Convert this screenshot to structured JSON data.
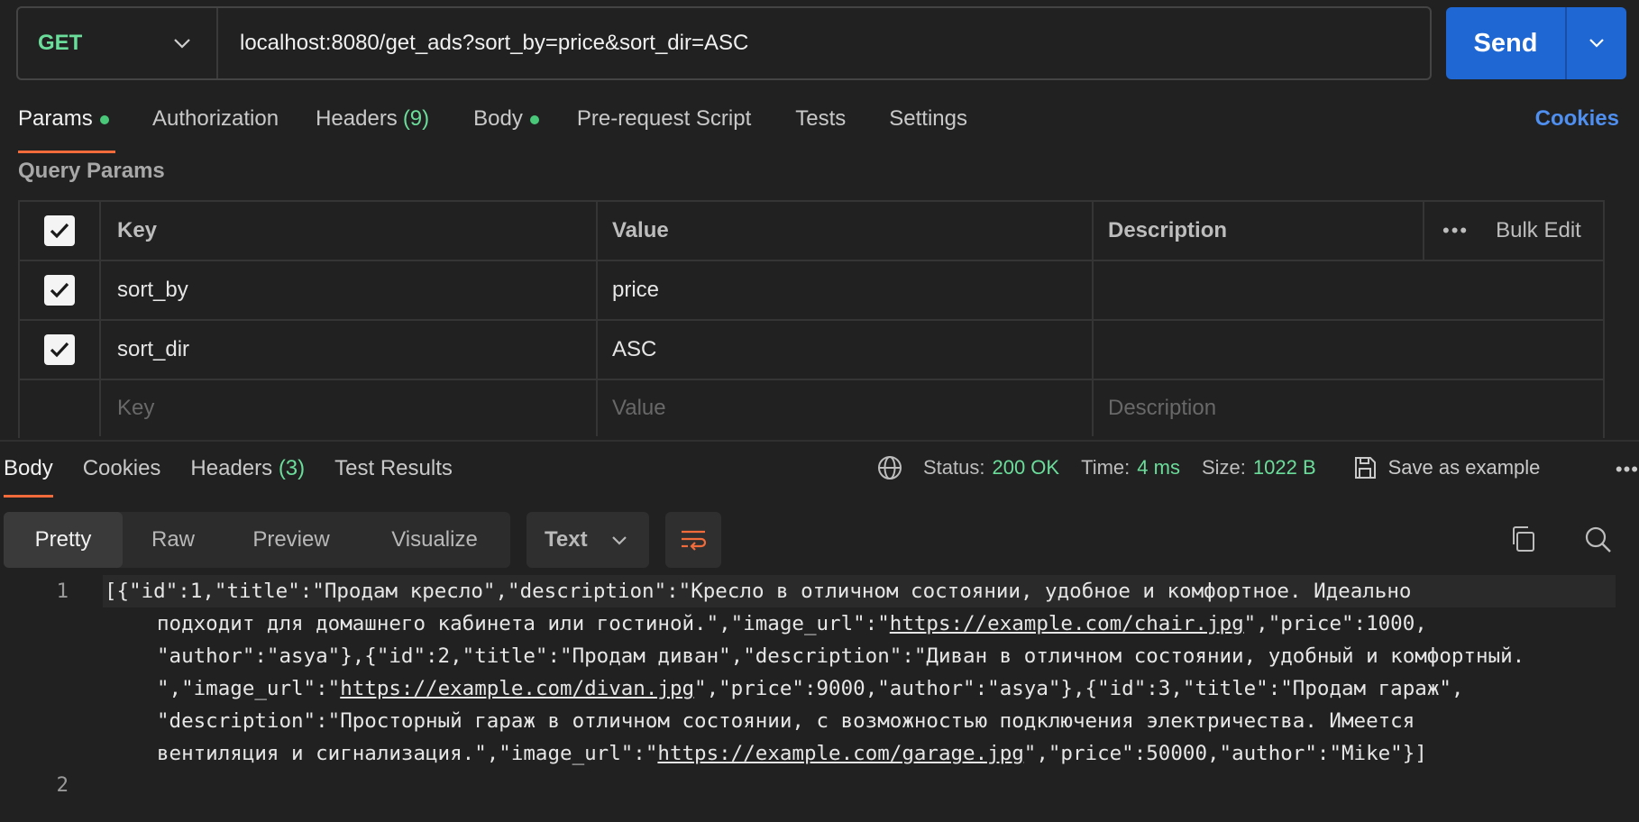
{
  "request": {
    "method": "GET",
    "url": "localhost:8080/get_ads?sort_by=price&sort_dir=ASC",
    "send_label": "Send"
  },
  "req_tabs": {
    "params": "Params",
    "authorization": "Authorization",
    "headers": "Headers",
    "headers_count": "(9)",
    "body": "Body",
    "pre_request": "Pre-request Script",
    "tests": "Tests",
    "settings": "Settings",
    "cookies": "Cookies"
  },
  "query_params": {
    "title": "Query Params",
    "headers": {
      "key": "Key",
      "value": "Value",
      "description": "Description",
      "bulk_edit": "Bulk Edit"
    },
    "rows": [
      {
        "key": "sort_by",
        "value": "price",
        "description": ""
      },
      {
        "key": "sort_dir",
        "value": "ASC",
        "description": ""
      }
    ],
    "placeholders": {
      "key": "Key",
      "value": "Value",
      "description": "Description"
    }
  },
  "response": {
    "tabs": {
      "body": "Body",
      "cookies": "Cookies",
      "headers": "Headers",
      "headers_count": "(3)",
      "test_results": "Test Results"
    },
    "status_label": "Status:",
    "status_value": "200 OK",
    "time_label": "Time:",
    "time_value": "4 ms",
    "size_label": "Size:",
    "size_value": "1022 B",
    "save_example": "Save as example",
    "views": {
      "pretty": "Pretty",
      "raw": "Raw",
      "preview": "Preview",
      "visualize": "Visualize"
    },
    "format": "Text",
    "code": {
      "line_numbers": [
        "1",
        "2"
      ],
      "l1": "[{\"id\":1,\"title\":\"Продам кресло\",\"description\":\"Кресло в отличном состоянии, удобное и комфортное. Идеально",
      "l2a": "подходит для домашнего кабинета или гостиной.\",\"image_url\":\"",
      "l2url": "https://example.com/chair.jpg",
      "l2b": "\",\"price\":1000,",
      "l3": "\"author\":\"asya\"},{\"id\":2,\"title\":\"Продам диван\",\"description\":\"Диван в отличном состоянии, удобный и комфортный.",
      "l4a": "\",\"image_url\":\"",
      "l4url": "https://example.com/divan.jpg",
      "l4b": "\",\"price\":9000,\"author\":\"asya\"},{\"id\":3,\"title\":\"Продам гараж\",",
      "l5": "\"description\":\"Просторный гараж в отличном состоянии, с возможностью подключения электричества. Имеется",
      "l6a": "вентиляция и сигнализация.\",\"image_url\":\"",
      "l6url": "https://example.com/garage.jpg",
      "l6b": "\",\"price\":50000,\"author\":\"Mike\"}]"
    }
  },
  "colors": {
    "accent": "#1f67d3",
    "success": "#6bdd9a",
    "tab_underline": "#f26b3a",
    "link": "#4f8ff0"
  }
}
